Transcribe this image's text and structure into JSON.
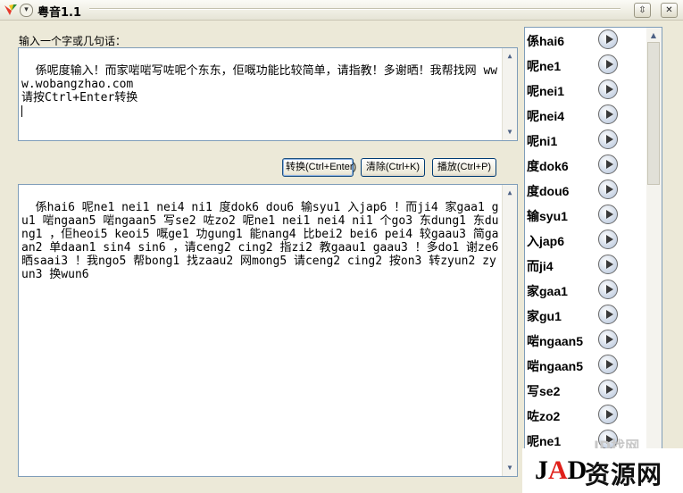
{
  "window": {
    "title": "粤音1.1",
    "sysmenu_glyph": "▾",
    "buttons": {
      "restore": "⇳",
      "close": "✕"
    }
  },
  "input": {
    "label": "输入一个字或几句话：",
    "value": "係呢度输入！而家啱啱写咗呢个东东，佢嘅功能比较简单，请指教！多谢晒！我帮找网 www.wobangzhao.com\n请按Ctrl+Enter转换\n"
  },
  "buttons": {
    "convert": "转换(Ctrl+Enter)",
    "clear": "清除(Ctrl+K)",
    "play": "播放(Ctrl+P)"
  },
  "output": {
    "value": "係hai6 呢ne1 nei1 nei4 ni1 度dok6 dou6 输syu1 入jap6 ！而ji4 家gaa1 gu1 啱ngaan5 啱ngaan5 写se2 咗zo2 呢ne1 nei1 nei4 ni1 个go3 东dung1 东dung1 ，佢heoi5 keoi5 嘅ge1 功gung1 能nang4 比bei2 bei6 pei4 较gaau3 简gaan2 单daan1 sin4 sin6 ，请ceng2 cing2 指zi2 教gaau1 gaau3 ！多do1 谢ze6 晒saai3 ！我ngo5 帮bong1 找zaau2 网mong5 请ceng2 cing2 按on3 转zyun2 zyun3 换wun6"
  },
  "pronunciations": [
    "係hai6",
    "呢ne1",
    "呢nei1",
    "呢nei4",
    "呢ni1",
    "度dok6",
    "度dou6",
    "输syu1",
    "入jap6",
    "而ji4",
    "家gaa1",
    "家gu1",
    "啱ngaan5",
    "啱ngaan5",
    "写se2",
    "咗zo2",
    "呢ne1"
  ],
  "watermark": {
    "logo_j": "J",
    "logo_a": "A",
    "logo_d": "D",
    "text": "资源网",
    "faint": "JD找网"
  }
}
